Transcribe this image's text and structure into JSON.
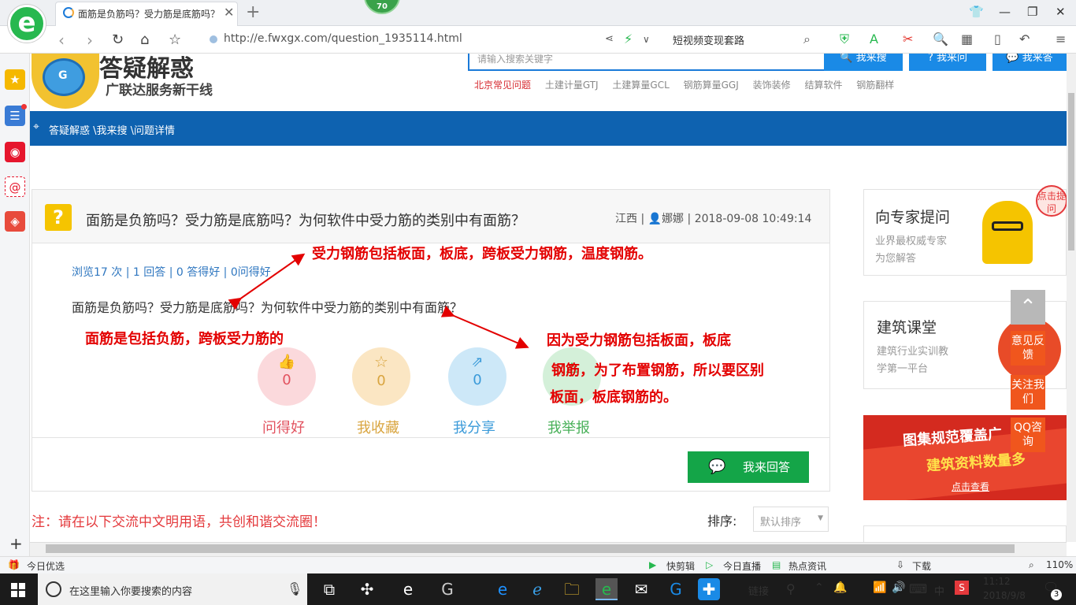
{
  "browser": {
    "tab_title": "面筋是负筋吗？受力筋是底筋吗？",
    "badge": "70",
    "url": "http://e.fwxgx.com/question_1935114.html",
    "search_text": "短视频变现套路",
    "zoom": "110%"
  },
  "header": {
    "logo_title": "答疑解惑",
    "logo_sub": "广联达服务新干线",
    "search_placeholder": "请输入搜索关键字",
    "btn_search": "我来搜",
    "btn_ask": "我来问",
    "btn_answer": "我来答",
    "nav": [
      "北京常见问题",
      "土建计量GTJ",
      "土建算量GCL",
      "钢筋算量GGJ",
      "装饰装修",
      "结算软件",
      "钢筋翻样"
    ]
  },
  "breadcrumb": "答疑解惑 \\我来搜 \\问题详情",
  "question": {
    "icon": "?",
    "title": "面筋是负筋吗？受力筋是底筋吗？为何软件中受力筋的类别中有面筋？",
    "region": "江西",
    "user": "娜娜",
    "time": "2018-09-08 10:49:14",
    "stats": "浏览17 次 | 1 回答 | 0 答得好 | 0问得好",
    "body": "面筋是负筋吗？受力筋是底筋吗？为何软件中受力筋的类别中有面筋？"
  },
  "actions": [
    {
      "label": "问得好",
      "count": "0"
    },
    {
      "label": "我收藏",
      "count": "0"
    },
    {
      "label": "我分享",
      "count": "0"
    },
    {
      "label": "我举报",
      "count": ""
    }
  ],
  "answer_btn": "我来回答",
  "notice": "注：请在以下交流中文明用语，共创和谐交流圈！",
  "sort": {
    "label": "排序:",
    "value": "默认排序"
  },
  "annotations": {
    "a1": "受力钢筋包括板面，板底，跨板受力钢筋，温度钢筋。",
    "a2": "面筋是包括负筋，跨板受力筋的",
    "a3_l1": "因为受力钢筋包括板面，板底",
    "a3_l2": "钢筋，为了布置钢筋，所以要区别",
    "a3_l3": "板面，板底钢筋的。"
  },
  "side": {
    "expert_title": "向专家提问",
    "expert_l1": "业界最权威专家",
    "expert_l2": "为您解答",
    "course_title": "建筑课堂",
    "course_l1": "建筑行业实训教",
    "course_l2": "学第一平台",
    "banner_l1": "图集规范覆盖广",
    "banner_l2": "建筑资料数量多",
    "banner_l3": "点击查看",
    "click_tip": "点击提问",
    "float_feedback": "意见反馈",
    "float_follow": "关注我们",
    "float_qq": "QQ咨询"
  },
  "status": {
    "left": "今日优选",
    "items": [
      "快剪辑",
      "今日直播",
      "热点资讯",
      "下载"
    ]
  },
  "taskbar": {
    "search": "在这里输入你要搜索的内容",
    "link": "链接",
    "ime": "中",
    "time": "11:12",
    "date": "2018/9/8",
    "notif": "3"
  },
  "colors": {
    "blue": "#0e62b0",
    "green": "#14a548",
    "red": "#e30000",
    "orange": "#f0561d"
  }
}
